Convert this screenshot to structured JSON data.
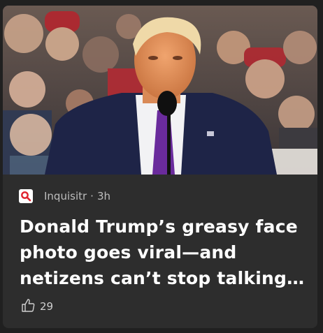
{
  "article": {
    "publisher": "Inquisitr",
    "separator": "·",
    "age": "3h",
    "headline": "Donald Trump’s greasy face photo goes viral—and netizens can’t stop talking…",
    "likes": "29"
  },
  "icons": {
    "publisher_logo": "magnifier-logo-icon",
    "like": "thumbs-up-icon"
  },
  "colors": {
    "card_background": "#2d2d2d",
    "page_background": "#202020",
    "publisher_logo_accent": "#e0232e",
    "headline_text": "#ffffff",
    "meta_text": "#bdbdbd"
  }
}
